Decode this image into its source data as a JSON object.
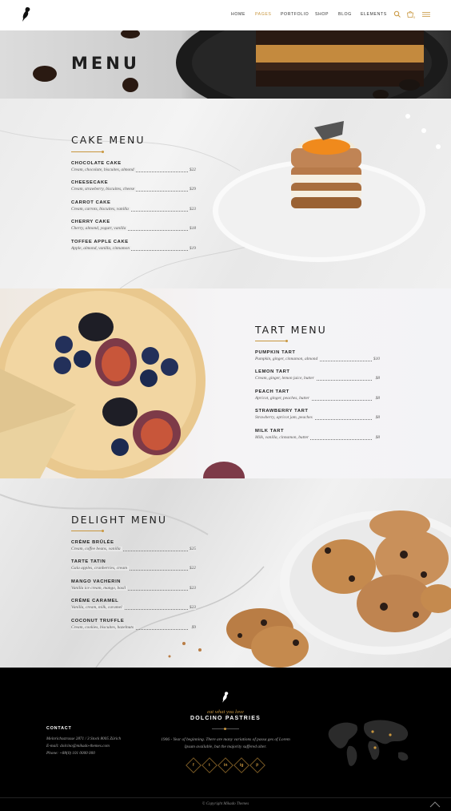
{
  "header": {
    "nav": [
      {
        "label": "HOME",
        "active": false
      },
      {
        "label": "PAGES",
        "active": true
      },
      {
        "label": "PORTFOLIO",
        "active": false
      },
      {
        "label": "SHOP",
        "active": false
      },
      {
        "label": "BLOG",
        "active": false
      },
      {
        "label": "ELEMENTS",
        "active": false
      }
    ],
    "icons": [
      "search-icon",
      "cart-icon",
      "menu-icon"
    ],
    "cart_count": "0"
  },
  "hero": {
    "title": "MENU"
  },
  "cake_menu": {
    "title": "CAKE MENU",
    "items": [
      {
        "name": "CHOCOLATE CAKE",
        "desc": "Cream, chocolate, biscuites, almond",
        "price": "$22"
      },
      {
        "name": "CHEESECAKE",
        "desc": "Cream, strawberry, biscuites, cheese",
        "price": "$29"
      },
      {
        "name": "CARROT CAKE",
        "desc": "Cream, carrots, biscuites, vanilla",
        "price": "$23"
      },
      {
        "name": "CHERRY CAKE",
        "desc": "Cherry, almond, yogurt, vanilla",
        "price": "$18"
      },
      {
        "name": "TOFFEE APPLE CAKE",
        "desc": "Apple, almond, vanilla, cinnamon",
        "price": "$19"
      }
    ]
  },
  "tart_menu": {
    "title": "TART MENU",
    "items": [
      {
        "name": "PUMPKIN TART",
        "desc": "Pumpkin, ginger, cinnamon, almond",
        "price": "$10"
      },
      {
        "name": "LEMON TART",
        "desc": "Cream, ginger, lemon juice, butter",
        "price": "$8"
      },
      {
        "name": "PEACH TART",
        "desc": "Apricot, ginger, peaches, butter",
        "price": "$8"
      },
      {
        "name": "STRAWBERRY TART",
        "desc": "Strawberry, apricot jam, peaches",
        "price": "$8"
      },
      {
        "name": "MILK TART",
        "desc": "Milk, vanilla, cinnamon, butter",
        "price": "$8"
      }
    ]
  },
  "delight_menu": {
    "title": "DELIGHT MENU",
    "items": [
      {
        "name": "CRÈME BRÛLÉE",
        "desc": "Cream, coffee beans, vanilla",
        "price": "$25"
      },
      {
        "name": "TARTE TATIN",
        "desc": "Gala apples, cranberries, cream",
        "price": "$22"
      },
      {
        "name": "MANGO VACHERIN",
        "desc": "Vanilla ice cream, mango, basil",
        "price": "$23"
      },
      {
        "name": "CRÈME CARAMEL",
        "desc": "Vanilla, cream, milk, caramel",
        "price": "$23"
      },
      {
        "name": "COCONUT TRUFFLE",
        "desc": "Cream, cookies, biscuites, hazelnuts",
        "price": "$9"
      }
    ]
  },
  "footer": {
    "tagline": "eat what you love",
    "brand": "DOLCINO PASTRIES",
    "contact_heading": "CONTACT",
    "contact_lines": [
      "Meinrichsstrasse 2871 / 3 Stock 8005 Zürich",
      "E-mail: dolcino@mikado-themes.com",
      "Phone: +88(0) 101 0000 000"
    ],
    "about": "1906 - Year of beginning. There are many variations of passa ges of Lorem Ipsum available, but the majority suffered alter.",
    "socials": [
      "f",
      "t",
      "in",
      "ig",
      "p"
    ],
    "copyright": "© Copyright Mikado Themes",
    "colors": {
      "accent": "#c8963e",
      "background": "#000000"
    }
  }
}
